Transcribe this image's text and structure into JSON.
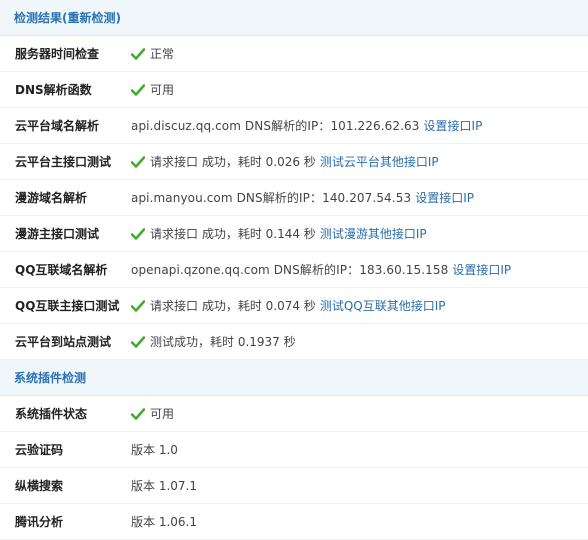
{
  "section1": {
    "title": "检测结果(重新检测)",
    "rows": [
      {
        "label": "服务器时间检查",
        "text": "正常"
      },
      {
        "label": "DNS解析函数",
        "text": "可用"
      },
      {
        "label": "云平台域名解析",
        "text": "api.discuz.qq.com DNS解析的IP：101.226.62.63",
        "link": "设置接口IP"
      },
      {
        "label": "云平台主接口测试",
        "text": "请求接口 成功，耗时 0.026 秒",
        "link": "测试云平台其他接口IP"
      },
      {
        "label": "漫游域名解析",
        "text": "api.manyou.com DNS解析的IP：140.207.54.53",
        "link": "设置接口IP"
      },
      {
        "label": "漫游主接口测试",
        "text": "请求接口 成功，耗时 0.144 秒",
        "link": "测试漫游其他接口IP"
      },
      {
        "label": "QQ互联域名解析",
        "text": "openapi.qzone.qq.com DNS解析的IP：183.60.15.158",
        "link": "设置接口IP"
      },
      {
        "label": "QQ互联主接口测试",
        "text": "请求接口 成功，耗时 0.074 秒",
        "link": "测试QQ互联其他接口IP"
      },
      {
        "label": "云平台到站点测试",
        "text": "测试成功，耗时 0.1937 秒"
      }
    ]
  },
  "section2": {
    "title": "系统插件检测",
    "rows": [
      {
        "label": "系统插件状态",
        "text": "可用"
      },
      {
        "label": "云验证码",
        "text": "版本 1.0"
      },
      {
        "label": "纵横搜索",
        "text": "版本 1.07.1"
      },
      {
        "label": "腾讯分析",
        "text": "版本 1.06.1"
      }
    ]
  },
  "icons": {
    "check": "check-icon",
    "check_color": "#3fae2a"
  }
}
